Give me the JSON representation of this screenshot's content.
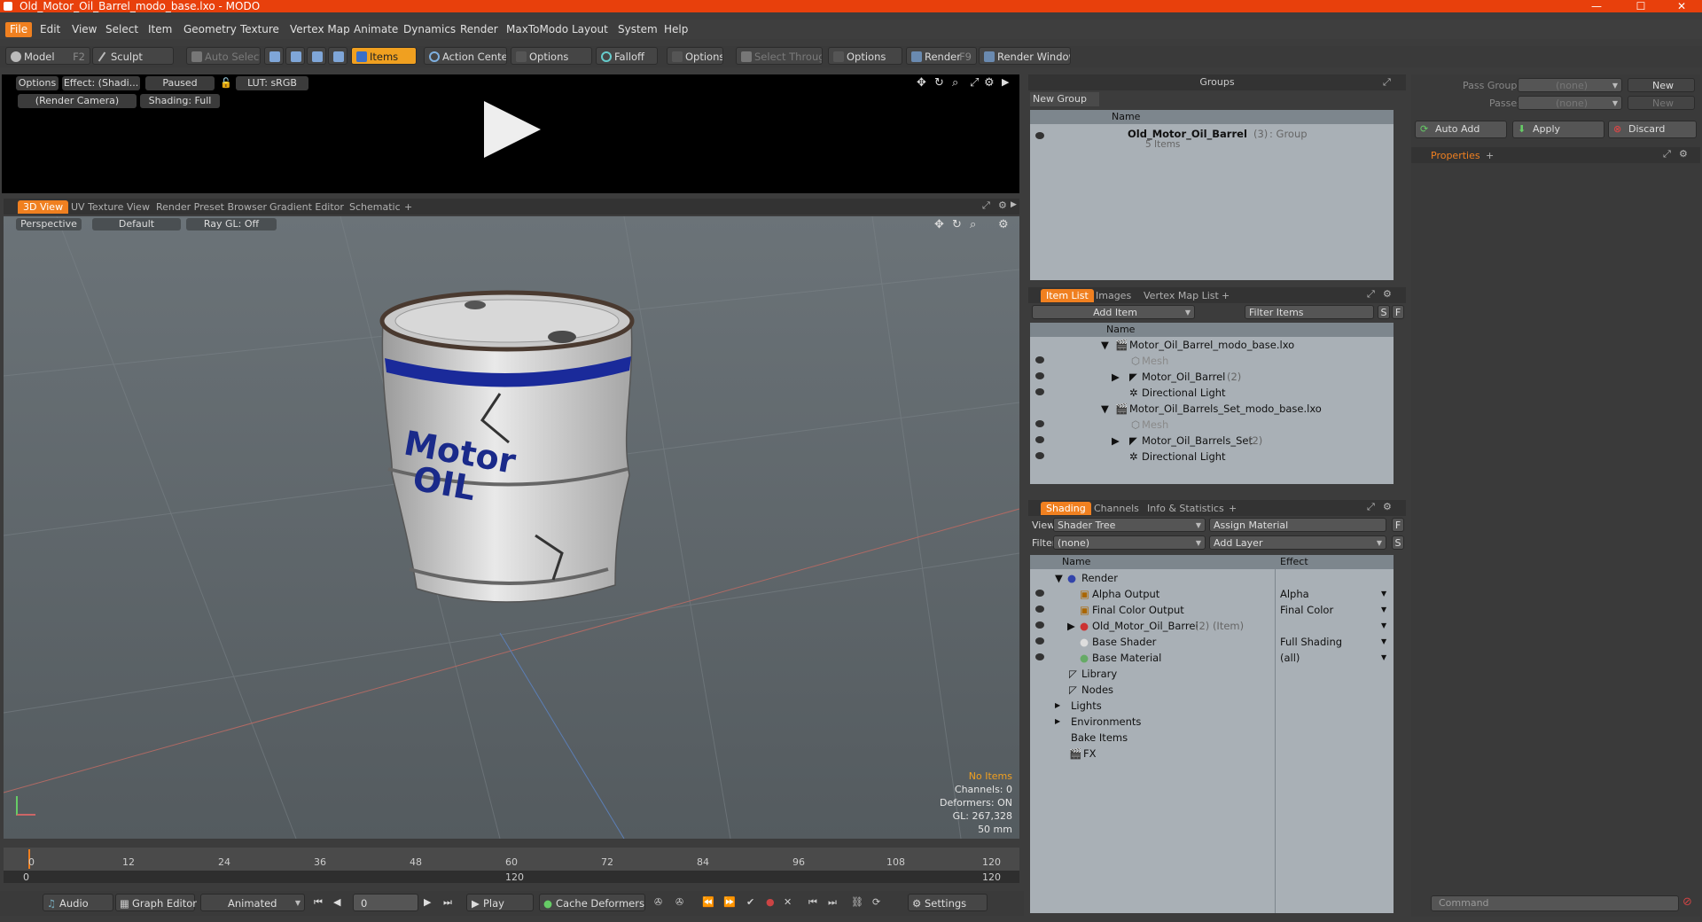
{
  "window": {
    "title": "Old_Motor_Oil_Barrel_modo_base.lxo - MODO",
    "minimize": "—",
    "maximize": "☐",
    "close": "✕"
  },
  "menu": [
    "File",
    "Edit",
    "View",
    "Select",
    "Item",
    "Geometry",
    "Texture",
    "Vertex Map",
    "Animate",
    "Dynamics",
    "Render",
    "MaxToModo",
    "Layout",
    "System",
    "Help"
  ],
  "toolbar": {
    "model": "Model",
    "model_key": "F2",
    "sculpt": "Sculpt",
    "auto_select": "Auto Select",
    "items": "Items",
    "action_center": "Action Center",
    "options1": "Options",
    "falloff": "Falloff",
    "options2": "Options",
    "select_through": "Select Through",
    "options3": "Options",
    "render": "Render",
    "render_key": "F9",
    "render_window": "Render Window"
  },
  "render_view": {
    "options": "Options",
    "effect": "Effect: (Shadi...",
    "paused": "Paused",
    "lut": "LUT: sRGB",
    "camera": "(Render Camera)",
    "shading": "Shading: Full"
  },
  "view_tabs": [
    "3D View",
    "UV Texture View",
    "Render Preset Browser",
    "Gradient Editor",
    "Schematic",
    "+"
  ],
  "viewport": {
    "perspective": "Perspective",
    "default": "Default",
    "raygl": "Ray GL: Off",
    "barrel_text_1": "Motor",
    "barrel_text_2": "OIL",
    "hud": {
      "no_items": "No Items",
      "channels": "Channels: 0",
      "deformers": "Deformers: ON",
      "gl": "GL: 267,328",
      "lens": "50 mm"
    }
  },
  "timeline": {
    "top_ticks": [
      "0",
      "12",
      "24",
      "36",
      "48",
      "60",
      "72",
      "84",
      "96",
      "108",
      "120"
    ],
    "bottom_ticks": [
      "0",
      "120",
      "120"
    ]
  },
  "bottombar": {
    "audio": "Audio",
    "graph_editor": "Graph Editor",
    "animated": "Animated",
    "frame": "0",
    "play": "Play",
    "cache_deformers": "Cache Deformers",
    "settings": "Settings"
  },
  "groups": {
    "header": "Groups",
    "new_group": "New Group",
    "col_name": "Name",
    "item_name": "Old_Motor_Oil_Barrel",
    "item_count": "(3)",
    "item_type": ": Group",
    "item_sub": "5 Items"
  },
  "pass": {
    "pass_groups": "Pass Groups",
    "passes": "Passes",
    "none1": "(none)",
    "none2": "(none)",
    "new1": "New",
    "new2": "New",
    "auto_add": "Auto Add",
    "apply": "Apply",
    "discard": "Discard",
    "properties": "Properties",
    "plus": "+"
  },
  "itemlist": {
    "tabs": [
      "Item List",
      "Images",
      "Vertex Map List",
      "+"
    ],
    "add_item": "Add Item",
    "filter": "Filter Items",
    "s": "S",
    "f": "F",
    "col_name": "Name",
    "rows": [
      {
        "label": "Motor_Oil_Barrel_modo_base.lxo",
        "count": ""
      },
      {
        "label": "Mesh",
        "count": ""
      },
      {
        "label": "Motor_Oil_Barrel",
        "count": "(2)"
      },
      {
        "label": "Directional Light",
        "count": ""
      },
      {
        "label": "Motor_Oil_Barrels_Set_modo_base.lxo",
        "count": ""
      },
      {
        "label": "Mesh",
        "count": ""
      },
      {
        "label": "Motor_Oil_Barrels_Set",
        "count": "(2)"
      },
      {
        "label": "Directional Light",
        "count": ""
      }
    ]
  },
  "shading": {
    "tabs": [
      "Shading",
      "Channels",
      "Info & Statistics",
      "+"
    ],
    "view_label": "View",
    "view_value": "Shader Tree",
    "assign_material": "Assign Material",
    "f": "F",
    "filter_label": "Filter",
    "filter_value": "(none)",
    "add_layer": "Add Layer",
    "s": "S",
    "col_name": "Name",
    "col_effect": "Effect",
    "rows": [
      {
        "label": "Render",
        "extra": "",
        "effect": ""
      },
      {
        "label": "Alpha Output",
        "extra": "",
        "effect": "Alpha"
      },
      {
        "label": "Final Color Output",
        "extra": "",
        "effect": "Final Color"
      },
      {
        "label": "Old_Motor_Oil_Barrel",
        "extra": "(2) (Item)",
        "effect": ""
      },
      {
        "label": "Base Shader",
        "extra": "",
        "effect": "Full Shading"
      },
      {
        "label": "Base Material",
        "extra": "",
        "effect": "(all)"
      },
      {
        "label": "Library",
        "extra": "",
        "effect": ""
      },
      {
        "label": "Nodes",
        "extra": "",
        "effect": ""
      },
      {
        "label": "Lights",
        "extra": "",
        "effect": ""
      },
      {
        "label": "Environments",
        "extra": "",
        "effect": ""
      },
      {
        "label": "Bake Items",
        "extra": "",
        "effect": ""
      },
      {
        "label": "FX",
        "extra": "",
        "effect": ""
      }
    ]
  },
  "command": {
    "placeholder": "Command"
  },
  "colors": {
    "accent": "#f08020",
    "titlebar": "#e8400c",
    "barrel_stripe": "#1a2a9a"
  }
}
